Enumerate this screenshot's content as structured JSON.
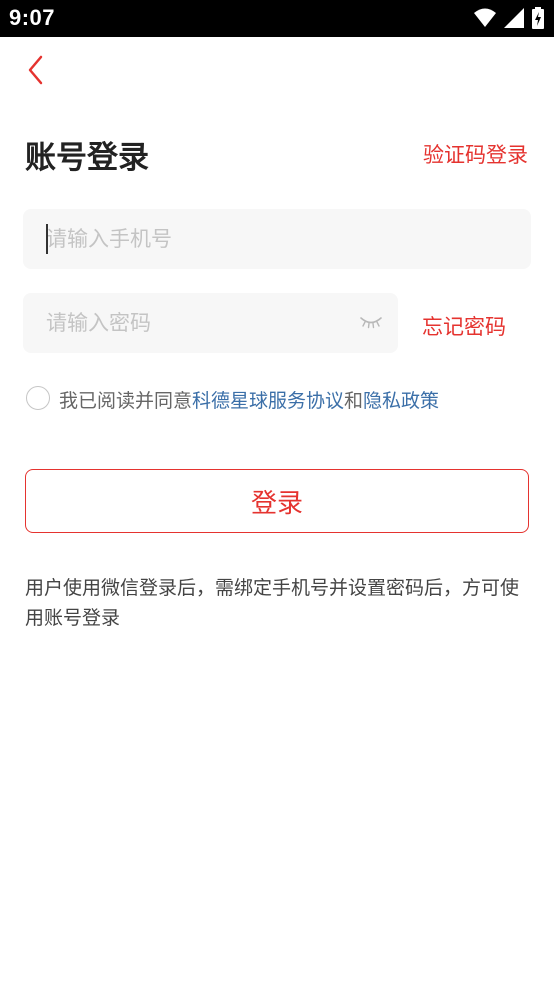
{
  "status_bar": {
    "time": "9:07",
    "icons": [
      "wifi-icon",
      "signal-icon",
      "battery-icon"
    ]
  },
  "nav": {
    "back_icon": "chevron-left-icon"
  },
  "header": {
    "title": "账号登录",
    "sms_login_label": "验证码登录"
  },
  "form": {
    "phone_placeholder": "请输入手机号",
    "password_placeholder": "请输入密码",
    "password_toggle_icon": "eye-closed-icon",
    "forgot_label": "忘记密码"
  },
  "agreement": {
    "prefix": "我已阅读并同意",
    "terms_label": "科德星球服务协议",
    "joiner": "和",
    "privacy_label": "隐私政策"
  },
  "login_label": "登录",
  "notice": "用户使用微信登录后，需绑定手机号并设置密码后，方可使用账号登录",
  "colors": {
    "accent": "#e5332f",
    "link": "#3b6fa8",
    "input_bg": "#f7f7f7",
    "placeholder": "#c4c4c4"
  }
}
